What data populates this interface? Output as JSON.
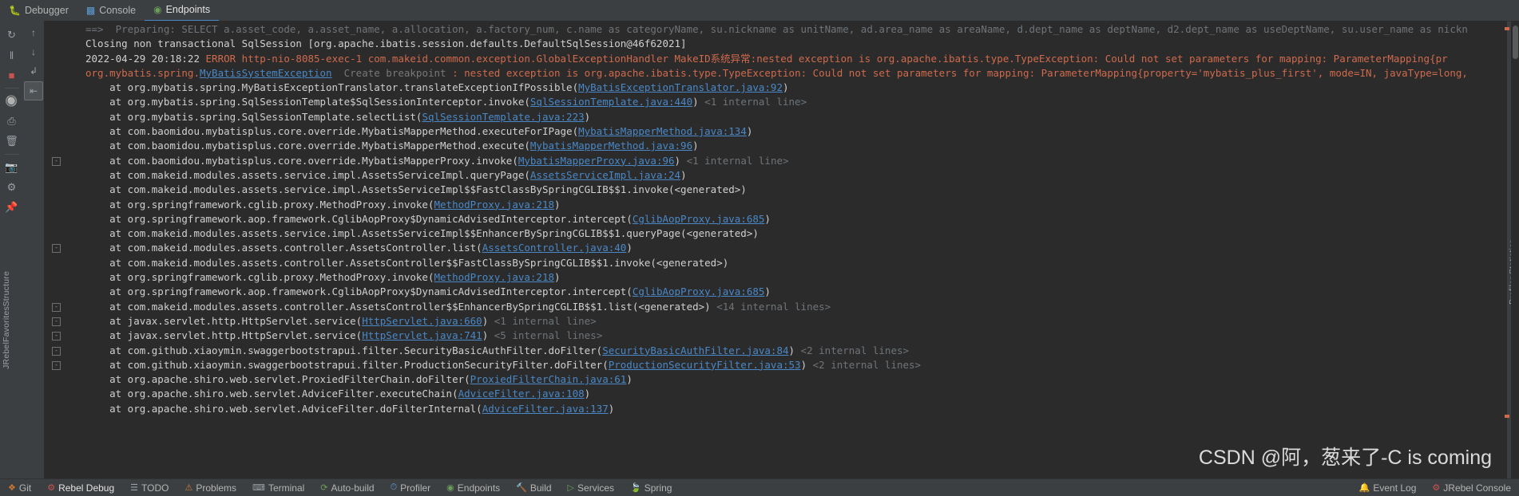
{
  "window": {
    "top_tabs": [
      {
        "label": "Debugger",
        "icon": "bug-icon",
        "active": false
      },
      {
        "label": "Console",
        "icon": "console-icon",
        "active": false
      },
      {
        "label": "Endpoints",
        "icon": "endpoints-icon",
        "active": true
      }
    ]
  },
  "left_gutter": {
    "icons": [
      {
        "name": "rerun-icon",
        "glyph": "↻"
      },
      {
        "name": "pause-icon",
        "glyph": "‖"
      },
      {
        "name": "stop-icon",
        "glyph": "■"
      },
      {
        "name": "step-over-icon",
        "glyph": "↓"
      },
      {
        "name": "camera-icon",
        "glyph": "▣"
      },
      {
        "name": "settings-icon",
        "glyph": "⚙"
      },
      {
        "name": "pin-icon",
        "glyph": "⚑"
      }
    ]
  },
  "second_gutter": {
    "icons": [
      {
        "name": "mute-breakpoints-icon",
        "glyph": "⊘"
      },
      {
        "name": "view-breakpoints-icon",
        "glyph": "▤"
      },
      {
        "name": "soft-wrap-icon",
        "glyph": "↵"
      },
      {
        "name": "print-icon",
        "glyph": "⎙"
      },
      {
        "name": "clear-all-icon",
        "glyph": "Ὕ1"
      }
    ]
  },
  "side_labels": {
    "left": [
      "Structure",
      "Favorites",
      "JRebel"
    ],
    "right": [
      "Profiler Statistics"
    ]
  },
  "console": {
    "lines": [
      {
        "fold": false,
        "segments": [
          {
            "t": "==>  Preparing: SELECT a.asset_code, a.asset_name, a.allocation, a.factory_num, c.name as categoryName, su.nickname as unitName, ad.area_name as areaName, d.dept_name as deptName, d2.dept_name as useDeptName, su.user_name as nickn",
            "c": "first"
          }
        ]
      },
      {
        "fold": false,
        "segments": [
          {
            "t": "Closing non transactional SqlSession [org.apache.ibatis.session.defaults.DefaultSqlSession@46f62021]",
            "c": "white"
          }
        ]
      },
      {
        "fold": false,
        "segments": [
          {
            "t": "2022-04-29 20:18:22 ",
            "c": "white"
          },
          {
            "t": "ERROR",
            "c": "errstrong"
          },
          {
            "t": " http-nio-8085-exec-1 com.makeid.common.exception.GlobalExceptionHandler MakeID系统异常:nested exception is org.apache.ibatis.type.TypeException: Could not set parameters for mapping: ParameterMapping{pr",
            "c": "err"
          }
        ]
      },
      {
        "fold": false,
        "segments": [
          {
            "t": "org.mybatis.spring.",
            "c": "err"
          },
          {
            "t": "MyBatisSystemException",
            "c": "lnk"
          },
          {
            "t": "  Create breakpoint",
            "c": "brk"
          },
          {
            "t": " : nested exception is org.apache.ibatis.type.TypeException: Could not set parameters for mapping: ParameterMapping{property='mybatis_plus_first', mode=IN, javaType=long,",
            "c": "err"
          }
        ]
      },
      {
        "fold": false,
        "segments": [
          {
            "t": "    at org.mybatis.spring.MyBatisExceptionTranslator.translateExceptionIfPossible(",
            "c": "white"
          },
          {
            "t": "MyBatisExceptionTranslator.java:92",
            "c": "lnk"
          },
          {
            "t": ")",
            "c": "white"
          }
        ]
      },
      {
        "fold": false,
        "segments": [
          {
            "t": "    at org.mybatis.spring.SqlSessionTemplate$SqlSessionInterceptor.invoke(",
            "c": "white"
          },
          {
            "t": "SqlSessionTemplate.java:440",
            "c": "lnk"
          },
          {
            "t": ") ",
            "c": "white"
          },
          {
            "t": "<1 internal line>",
            "c": "note"
          }
        ]
      },
      {
        "fold": false,
        "segments": [
          {
            "t": "    at org.mybatis.spring.SqlSessionTemplate.selectList(",
            "c": "white"
          },
          {
            "t": "SqlSessionTemplate.java:223",
            "c": "lnk"
          },
          {
            "t": ")",
            "c": "white"
          }
        ]
      },
      {
        "fold": false,
        "segments": [
          {
            "t": "    at com.baomidou.mybatisplus.core.override.MybatisMapperMethod.executeForIPage(",
            "c": "white"
          },
          {
            "t": "MybatisMapperMethod.java:134",
            "c": "lnk"
          },
          {
            "t": ")",
            "c": "white"
          }
        ]
      },
      {
        "fold": false,
        "segments": [
          {
            "t": "    at com.baomidou.mybatisplus.core.override.MybatisMapperMethod.execute(",
            "c": "white"
          },
          {
            "t": "MybatisMapperMethod.java:96",
            "c": "lnk"
          },
          {
            "t": ")",
            "c": "white"
          }
        ]
      },
      {
        "fold": true,
        "segments": [
          {
            "t": "    at com.baomidou.mybatisplus.core.override.MybatisMapperProxy.invoke(",
            "c": "white"
          },
          {
            "t": "MybatisMapperProxy.java:96",
            "c": "lnk"
          },
          {
            "t": ") ",
            "c": "white"
          },
          {
            "t": "<1 internal line>",
            "c": "note"
          }
        ]
      },
      {
        "fold": false,
        "segments": [
          {
            "t": "    at com.makeid.modules.assets.service.impl.AssetsServiceImpl.queryPage(",
            "c": "white"
          },
          {
            "t": "AssetsServiceImpl.java:24",
            "c": "lnk"
          },
          {
            "t": ")",
            "c": "white"
          }
        ]
      },
      {
        "fold": false,
        "segments": [
          {
            "t": "    at com.makeid.modules.assets.service.impl.AssetsServiceImpl$$FastClassBySpringCGLIB$$1.invoke(<generated>)",
            "c": "white"
          }
        ]
      },
      {
        "fold": false,
        "segments": [
          {
            "t": "    at org.springframework.cglib.proxy.MethodProxy.invoke(",
            "c": "white"
          },
          {
            "t": "MethodProxy.java:218",
            "c": "lnk"
          },
          {
            "t": ")",
            "c": "white"
          }
        ]
      },
      {
        "fold": false,
        "segments": [
          {
            "t": "    at org.springframework.aop.framework.CglibAopProxy$DynamicAdvisedInterceptor.intercept(",
            "c": "white"
          },
          {
            "t": "CglibAopProxy.java:685",
            "c": "lnk"
          },
          {
            "t": ")",
            "c": "white"
          }
        ]
      },
      {
        "fold": false,
        "segments": [
          {
            "t": "    at com.makeid.modules.assets.service.impl.AssetsServiceImpl$$EnhancerBySpringCGLIB$$1.queryPage(<generated>)",
            "c": "white"
          }
        ]
      },
      {
        "fold": true,
        "segments": [
          {
            "t": "    at com.makeid.modules.assets.controller.AssetsController.list(",
            "c": "white"
          },
          {
            "t": "AssetsController.java:40",
            "c": "lnk"
          },
          {
            "t": ")",
            "c": "white"
          }
        ]
      },
      {
        "fold": false,
        "segments": [
          {
            "t": "    at com.makeid.modules.assets.controller.AssetsController$$FastClassBySpringCGLIB$$1.invoke(<generated>)",
            "c": "white"
          }
        ]
      },
      {
        "fold": false,
        "segments": [
          {
            "t": "    at org.springframework.cglib.proxy.MethodProxy.invoke(",
            "c": "white"
          },
          {
            "t": "MethodProxy.java:218",
            "c": "lnk"
          },
          {
            "t": ")",
            "c": "white"
          }
        ]
      },
      {
        "fold": false,
        "segments": [
          {
            "t": "    at org.springframework.aop.framework.CglibAopProxy$DynamicAdvisedInterceptor.intercept(",
            "c": "white"
          },
          {
            "t": "CglibAopProxy.java:685",
            "c": "lnk"
          },
          {
            "t": ")",
            "c": "white"
          }
        ]
      },
      {
        "fold": true,
        "segments": [
          {
            "t": "    at com.makeid.modules.assets.controller.AssetsController$$EnhancerBySpringCGLIB$$1.list(<generated>) ",
            "c": "white"
          },
          {
            "t": "<14 internal lines>",
            "c": "note"
          }
        ]
      },
      {
        "fold": true,
        "segments": [
          {
            "t": "    at javax.servlet.http.HttpServlet.service(",
            "c": "white"
          },
          {
            "t": "HttpServlet.java:660",
            "c": "lnk"
          },
          {
            "t": ") ",
            "c": "white"
          },
          {
            "t": "<1 internal line>",
            "c": "note"
          }
        ]
      },
      {
        "fold": true,
        "segments": [
          {
            "t": "    at javax.servlet.http.HttpServlet.service(",
            "c": "white"
          },
          {
            "t": "HttpServlet.java:741",
            "c": "lnk"
          },
          {
            "t": ") ",
            "c": "white"
          },
          {
            "t": "<5 internal lines>",
            "c": "note"
          }
        ]
      },
      {
        "fold": true,
        "segments": [
          {
            "t": "    at com.github.xiaoymin.swaggerbootstrapui.filter.SecurityBasicAuthFilter.doFilter(",
            "c": "white"
          },
          {
            "t": "SecurityBasicAuthFilter.java:84",
            "c": "lnk"
          },
          {
            "t": ") ",
            "c": "white"
          },
          {
            "t": "<2 internal lines>",
            "c": "note"
          }
        ]
      },
      {
        "fold": true,
        "segments": [
          {
            "t": "    at com.github.xiaoymin.swaggerbootstrapui.filter.ProductionSecurityFilter.doFilter(",
            "c": "white"
          },
          {
            "t": "ProductionSecurityFilter.java:53",
            "c": "lnk"
          },
          {
            "t": ") ",
            "c": "white"
          },
          {
            "t": "<2 internal lines>",
            "c": "note"
          }
        ]
      },
      {
        "fold": false,
        "segments": [
          {
            "t": "    at org.apache.shiro.web.servlet.ProxiedFilterChain.doFilter(",
            "c": "white"
          },
          {
            "t": "ProxiedFilterChain.java:61",
            "c": "lnk"
          },
          {
            "t": ")",
            "c": "white"
          }
        ]
      },
      {
        "fold": false,
        "segments": [
          {
            "t": "    at org.apache.shiro.web.servlet.AdviceFilter.executeChain(",
            "c": "white"
          },
          {
            "t": "AdviceFilter.java:108",
            "c": "lnk"
          },
          {
            "t": ")",
            "c": "white"
          }
        ]
      },
      {
        "fold": false,
        "segments": [
          {
            "t": "    at org.apache.shiro.web.servlet.AdviceFilter.doFilterInternal(",
            "c": "white"
          },
          {
            "t": "AdviceFilter.java:137",
            "c": "lnk"
          },
          {
            "t": ")",
            "c": "white"
          }
        ]
      }
    ]
  },
  "watermark": "CSDN @阿，葱来了-C is coming",
  "statusbar": {
    "left_items": [
      {
        "label": "Git",
        "icon": "git-icon"
      },
      {
        "label": "Rebel Debug",
        "icon": "rebel-icon",
        "active": true
      },
      {
        "label": "TODO",
        "icon": "todo-icon"
      },
      {
        "label": "Problems",
        "icon": "problems-icon"
      },
      {
        "label": "Terminal",
        "icon": "terminal-icon"
      },
      {
        "label": "Auto-build",
        "icon": "autobuild-icon"
      },
      {
        "label": "Profiler",
        "icon": "profiler-icon"
      },
      {
        "label": "Endpoints",
        "icon": "endpoints-icon"
      },
      {
        "label": "Build",
        "icon": "build-icon"
      },
      {
        "label": "Services",
        "icon": "services-icon"
      },
      {
        "label": "Spring",
        "icon": "spring-icon"
      }
    ],
    "right_items": [
      {
        "label": "Event Log",
        "icon": "event-log-icon"
      },
      {
        "label": "JRebel Console",
        "icon": "jrebel-icon"
      }
    ]
  }
}
